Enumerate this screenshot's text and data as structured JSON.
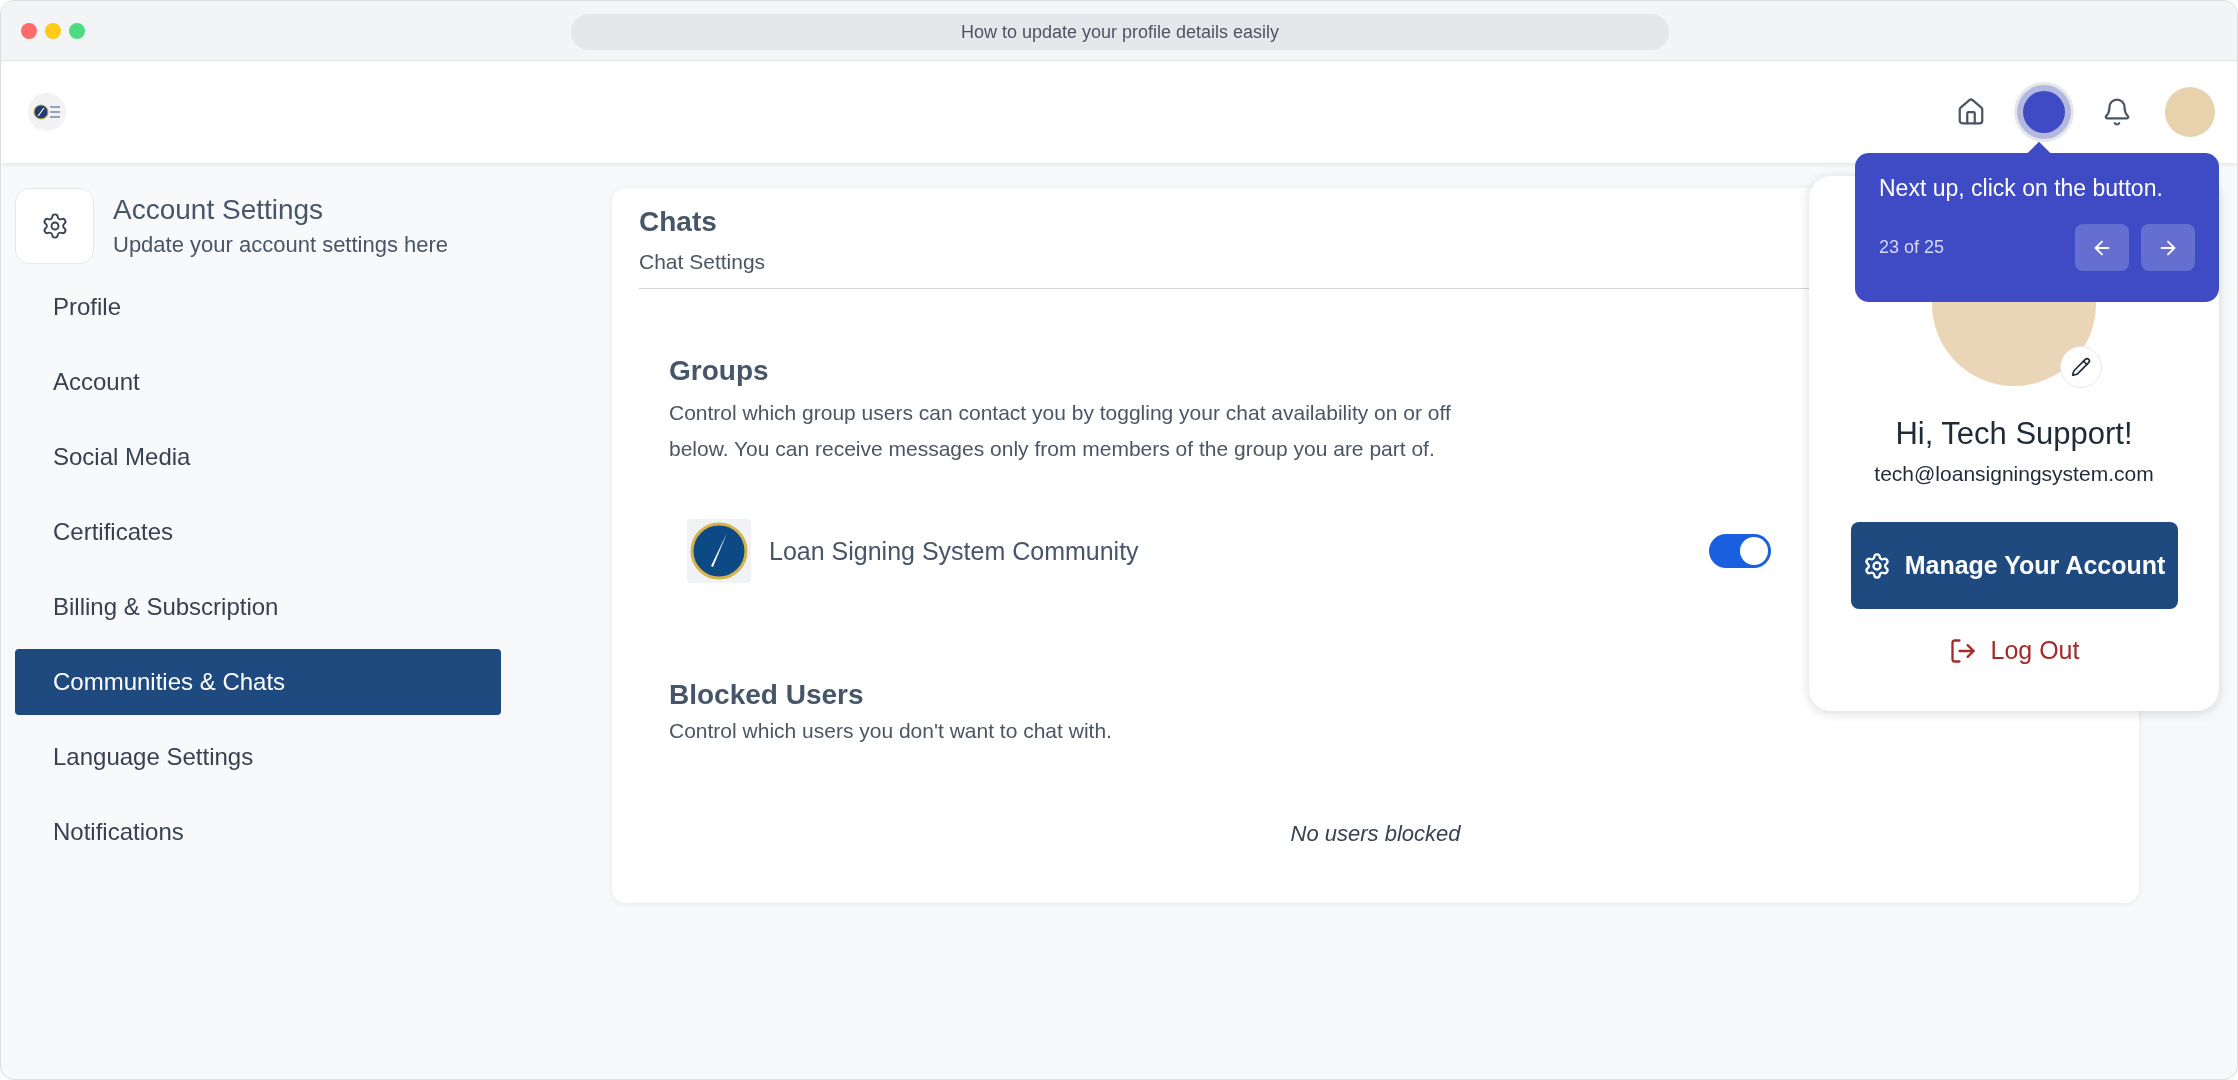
{
  "window": {
    "title": "How to update your profile details easily"
  },
  "sidebar": {
    "title": "Account Settings",
    "subtitle": "Update your account settings here",
    "items": [
      {
        "label": "Profile",
        "selected": false
      },
      {
        "label": "Account",
        "selected": false
      },
      {
        "label": "Social Media",
        "selected": false
      },
      {
        "label": "Certificates",
        "selected": false
      },
      {
        "label": "Billing & Subscription",
        "selected": false
      },
      {
        "label": "Communities & Chats",
        "selected": true
      },
      {
        "label": "Language Settings",
        "selected": false
      },
      {
        "label": "Notifications",
        "selected": false
      }
    ]
  },
  "chats": {
    "title": "Chats",
    "subtitle": "Chat Settings",
    "groups": {
      "title": "Groups",
      "description": "Control which group users can contact you by toggling your chat availability on or off below. You can receive messages only from members of the group you are part of.",
      "items": [
        {
          "name": "Loan Signing System Community",
          "on": true
        }
      ]
    },
    "blocked": {
      "title": "Blocked Users",
      "description": "Control which users you don't want to chat with.",
      "empty": "No users blocked"
    }
  },
  "account_menu": {
    "greeting": "Hi, Tech Support!",
    "email": "tech@loansigningsystem.com",
    "manage_button": "Manage Your Account",
    "logout": "Log Out"
  },
  "tour_tooltip": {
    "text": "Next up, click on the button.",
    "step": "23 of 25"
  }
}
